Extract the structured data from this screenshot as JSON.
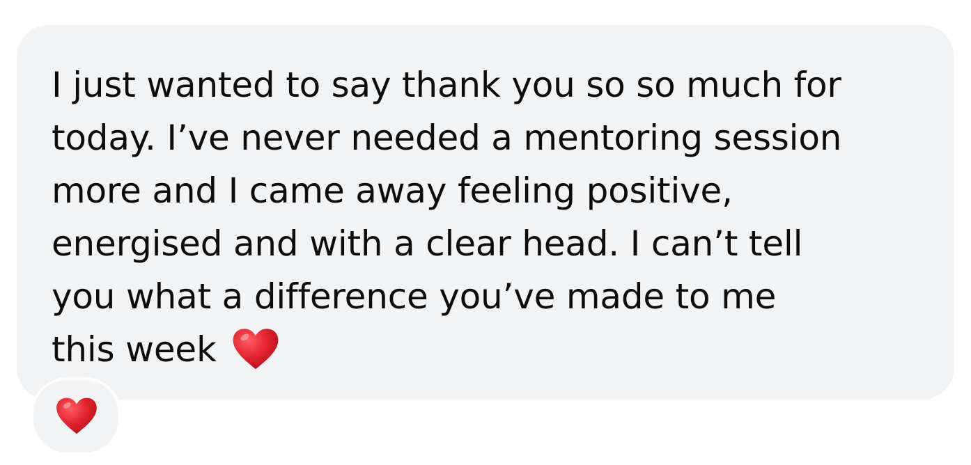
{
  "message": {
    "lines": [
      "I just wanted to say thank you so so much for",
      "today. I’ve never needed a mentoring session",
      "more and I came away feeling positive,",
      "energised and with a clear head. I can’t tell",
      "you what a difference you’ve made to me",
      "this week"
    ],
    "inline_emoji": "red-heart-icon"
  },
  "reaction": {
    "emoji": "red-heart-icon"
  },
  "colors": {
    "bubble_background": "#f2f3f5",
    "text": "#0c0c0c",
    "heart": "#e3232e"
  }
}
